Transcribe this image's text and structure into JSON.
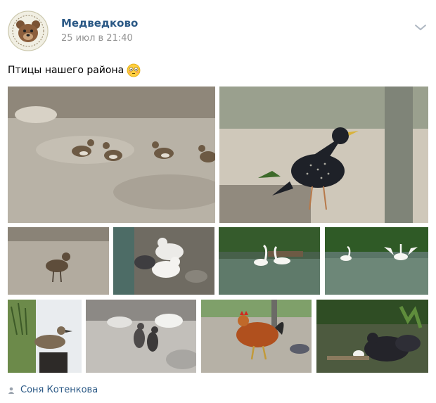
{
  "post": {
    "author": "Медведково",
    "date": "25 июл в 21:40",
    "text": "Птицы нашего района",
    "emoji": "flushed-face-emoji",
    "signer": "Соня Котенкова"
  },
  "avatar": {
    "logo_icon": "bear-logo-icon"
  },
  "icons": {
    "menu": "chevron-down-icon",
    "signer": "person-icon"
  },
  "photos": [
    {
      "id": "sparrows"
    },
    {
      "id": "starling"
    },
    {
      "id": "sparrow-single"
    },
    {
      "id": "doves"
    },
    {
      "id": "swans-pond"
    },
    {
      "id": "swans-flapping"
    },
    {
      "id": "duck-on-post"
    },
    {
      "id": "pigeons-chicks"
    },
    {
      "id": "rooster"
    },
    {
      "id": "black-hens"
    }
  ]
}
